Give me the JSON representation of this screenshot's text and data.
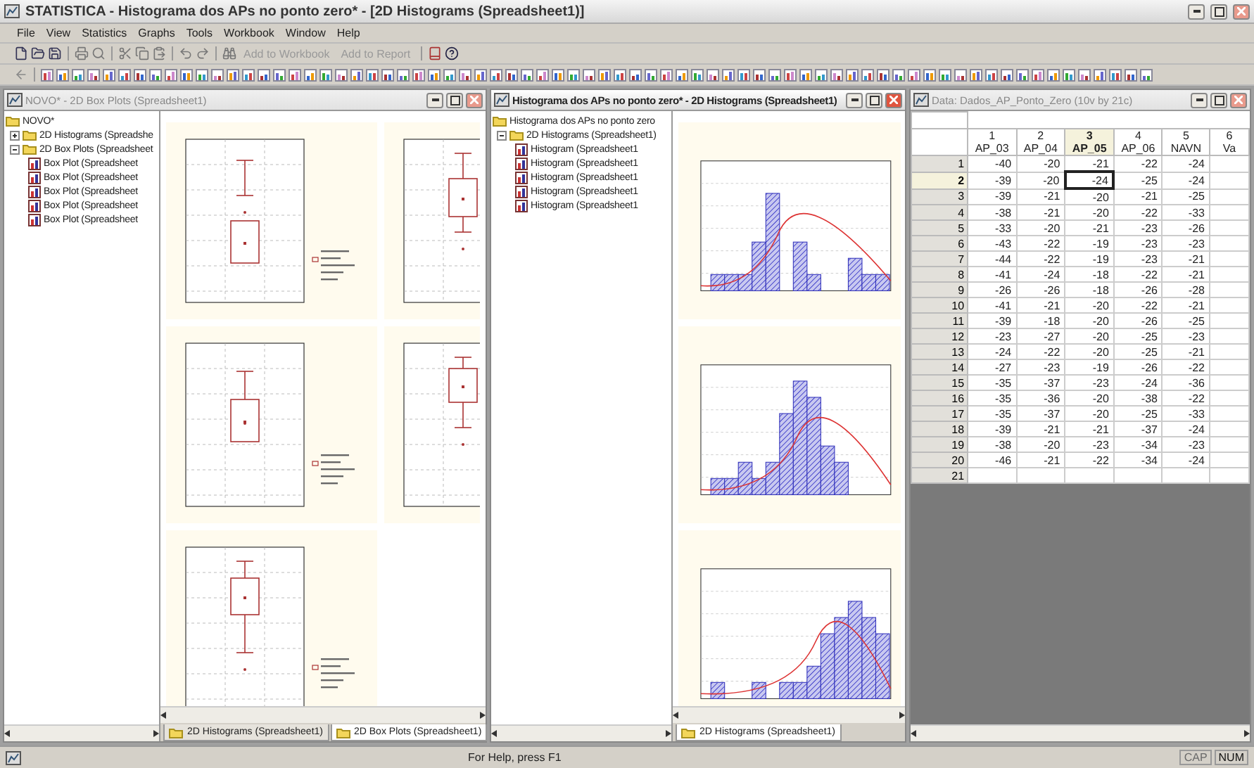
{
  "app_window": {
    "title": "STATISTICA - Histograma dos APs no ponto zero* - [2D Histograms (Spreadsheet1)]"
  },
  "menu": [
    "File",
    "View",
    "Statistics",
    "Graphs",
    "Tools",
    "Workbook",
    "Window",
    "Help"
  ],
  "toolbar": {
    "buttons": [
      {
        "label": "Add to Workbook",
        "disabled": true
      },
      {
        "label": "Add to Report",
        "disabled": true
      }
    ]
  },
  "windows": [
    {
      "title": "NOVO* - 2D Box Plots (Spreadsheet1)",
      "active": false,
      "tree": {
        "label": "NOVO*",
        "children": [
          {
            "label": "2D Histograms (Spreadshe",
            "expanded": false
          },
          {
            "label": "2D Box Plots (Spreadsheet",
            "expanded": true,
            "children": [
              {
                "label": "Box Plot (Spreadsheet"
              },
              {
                "label": "Box Plot (Spreadsheet"
              },
              {
                "label": "Box Plot (Spreadsheet"
              },
              {
                "label": "Box Plot (Spreadsheet"
              },
              {
                "label": "Box Plot (Spreadsheet"
              }
            ]
          }
        ]
      },
      "graphs": [
        {
          "kind": "box_plot"
        },
        {
          "kind": "box_plot"
        },
        {
          "kind": "box_plot"
        },
        {
          "kind": "box_plot"
        },
        {
          "kind": "box_plot"
        }
      ],
      "tabs": [
        {
          "label": "2D Histograms (Spreadsheet1)",
          "selected": false
        },
        {
          "label": "2D Box Plots (Spreadsheet1)",
          "selected": true
        }
      ]
    },
    {
      "title": "Histograma dos APs no ponto zero* - 2D Histograms (Spreadsheet1)",
      "active": true,
      "tree": {
        "label": "Histograma dos APs no ponto zero",
        "children": [
          {
            "label": "2D Histograms (Spreadsheet1)",
            "expanded": true,
            "children": [
              {
                "label": "Histogram (Spreadsheet1"
              },
              {
                "label": "Histogram (Spreadsheet1"
              },
              {
                "label": "Histogram (Spreadsheet1"
              },
              {
                "label": "Histogram (Spreadsheet1"
              },
              {
                "label": "Histogram (Spreadsheet1"
              }
            ]
          }
        ]
      },
      "graphs": [
        {
          "kind": "histogram"
        },
        {
          "kind": "histogram"
        },
        {
          "kind": "histogram"
        }
      ],
      "tabs": [
        {
          "label": "2D Histograms (Spreadsheet1)",
          "selected": true
        }
      ]
    }
  ],
  "spreadsheet": {
    "title": "Data: Dados_AP_Ponto_Zero (10v by 21c)",
    "active": false,
    "columns": [
      {
        "number": "1",
        "name": "AP_03",
        "selected": false
      },
      {
        "number": "2",
        "name": "AP_04",
        "selected": false
      },
      {
        "number": "3",
        "name": "AP_05",
        "selected": true
      },
      {
        "number": "4",
        "name": "AP_06",
        "selected": false
      },
      {
        "number": "5",
        "name": "NAVN",
        "selected": false
      },
      {
        "number": "6",
        "name": "Va",
        "selected": false
      }
    ],
    "rows": [
      {
        "label": "1",
        "selected": false,
        "cells": [
          "-40",
          "-20",
          "-21",
          "-22",
          "-24"
        ]
      },
      {
        "label": "2",
        "selected": true,
        "cells": [
          "-39",
          "-20",
          "-24",
          "-25",
          "-24"
        ]
      },
      {
        "label": "3",
        "selected": false,
        "cells": [
          "-39",
          "-21",
          "-20",
          "-21",
          "-25"
        ]
      },
      {
        "label": "4",
        "selected": false,
        "cells": [
          "-38",
          "-21",
          "-20",
          "-22",
          "-33"
        ]
      },
      {
        "label": "5",
        "selected": false,
        "cells": [
          "-33",
          "-20",
          "-21",
          "-23",
          "-26"
        ]
      },
      {
        "label": "6",
        "selected": false,
        "cells": [
          "-43",
          "-22",
          "-19",
          "-23",
          "-23"
        ]
      },
      {
        "label": "7",
        "selected": false,
        "cells": [
          "-44",
          "-22",
          "-19",
          "-23",
          "-21"
        ]
      },
      {
        "label": "8",
        "selected": false,
        "cells": [
          "-41",
          "-24",
          "-18",
          "-22",
          "-21"
        ]
      },
      {
        "label": "9",
        "selected": false,
        "cells": [
          "-26",
          "-26",
          "-18",
          "-26",
          "-28"
        ]
      },
      {
        "label": "10",
        "selected": false,
        "cells": [
          "-41",
          "-21",
          "-20",
          "-22",
          "-21"
        ]
      },
      {
        "label": "11",
        "selected": false,
        "cells": [
          "-39",
          "-18",
          "-20",
          "-26",
          "-25"
        ]
      },
      {
        "label": "12",
        "selected": false,
        "cells": [
          "-23",
          "-27",
          "-20",
          "-25",
          "-23"
        ]
      },
      {
        "label": "13",
        "selected": false,
        "cells": [
          "-24",
          "-22",
          "-20",
          "-25",
          "-21"
        ]
      },
      {
        "label": "14",
        "selected": false,
        "cells": [
          "-27",
          "-23",
          "-19",
          "-26",
          "-22"
        ]
      },
      {
        "label": "15",
        "selected": false,
        "cells": [
          "-35",
          "-37",
          "-23",
          "-24",
          "-36"
        ]
      },
      {
        "label": "16",
        "selected": false,
        "cells": [
          "-35",
          "-36",
          "-20",
          "-38",
          "-22"
        ]
      },
      {
        "label": "17",
        "selected": false,
        "cells": [
          "-35",
          "-37",
          "-20",
          "-25",
          "-33"
        ]
      },
      {
        "label": "18",
        "selected": false,
        "cells": [
          "-39",
          "-21",
          "-21",
          "-37",
          "-24"
        ]
      },
      {
        "label": "19",
        "selected": false,
        "cells": [
          "-38",
          "-20",
          "-23",
          "-34",
          "-23"
        ]
      },
      {
        "label": "20",
        "selected": false,
        "cells": [
          "-46",
          "-21",
          "-22",
          "-34",
          "-24"
        ]
      },
      {
        "label": "21",
        "selected": false
      }
    ]
  },
  "status_bar": {
    "message": "For Help, press F1",
    "indicators": [
      {
        "label": "CAP",
        "on": false
      },
      {
        "label": "NUM",
        "on": true
      }
    ]
  }
}
